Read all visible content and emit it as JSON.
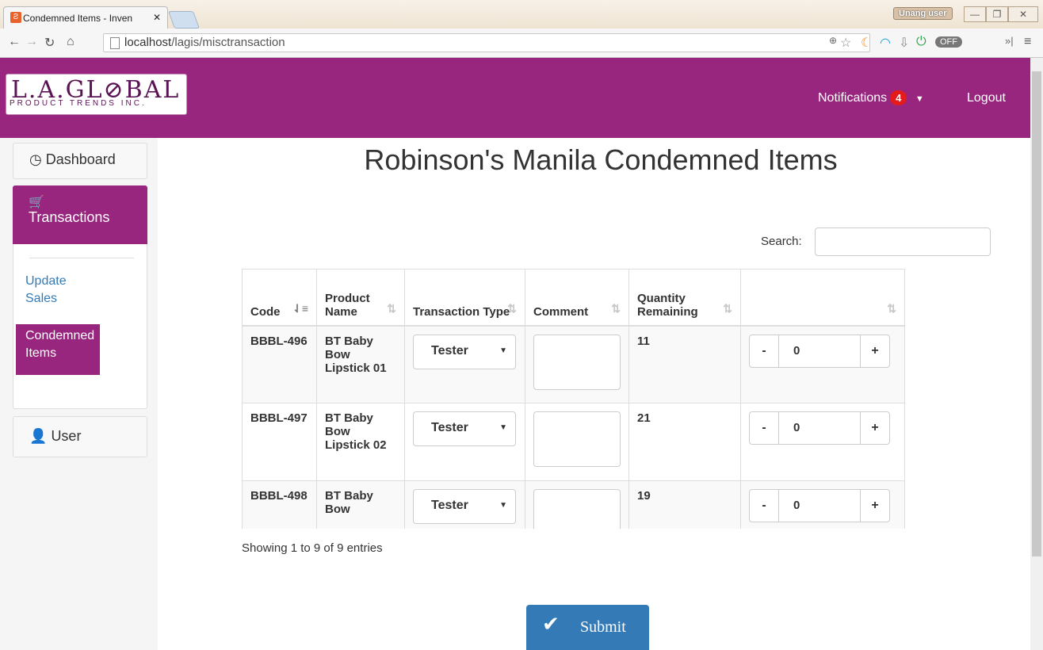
{
  "browser": {
    "tab_title": "Condemned Items - Inven",
    "tab_close": "✕",
    "user_badge": "Unang user",
    "url_host": "localhost",
    "url_path": "/lagis/misctransaction"
  },
  "header": {
    "logo_top": "L.A.GL⊘BAL",
    "logo_bottom": "PRODUCT TRENDS INC.",
    "notifications_label": "Notifications",
    "notifications_count": "4",
    "logout_label": "Logout"
  },
  "sidebar": {
    "dashboard": "Dashboard",
    "transactions": "Transactions",
    "update_sales": "Update Sales",
    "condemned_items": "Condemned Items",
    "user": "User"
  },
  "main": {
    "title": "Robinson's Manila Condemned Items",
    "search_label": "Search:",
    "columns": [
      "Code",
      "Product Name",
      "Transaction Type",
      "Comment",
      "Quantity Remaining",
      ""
    ],
    "rows": [
      {
        "code": "BBBL-496",
        "name": "BT Baby Bow Lipstick 01",
        "type": "Tester",
        "qty": "11",
        "step": "0"
      },
      {
        "code": "BBBL-497",
        "name": "BT Baby Bow Lipstick 02",
        "type": "Tester",
        "qty": "21",
        "step": "0"
      },
      {
        "code": "BBBL-498",
        "name": "BT Baby Bow",
        "type": "Tester",
        "qty": "19",
        "step": "0"
      }
    ],
    "showing": "Showing 1 to 9 of 9 entries",
    "submit": "Submit"
  }
}
